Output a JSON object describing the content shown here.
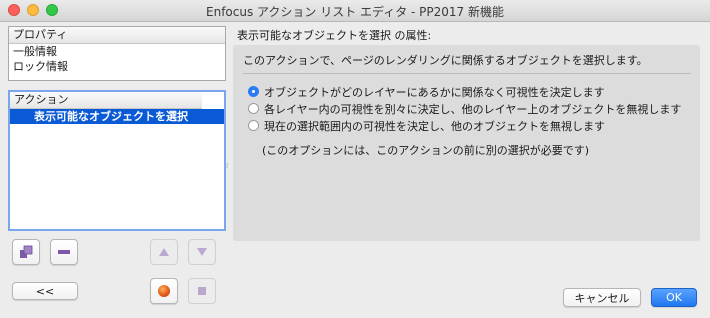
{
  "window": {
    "title": "Enfocus アクション リスト エディタ - PP2017 新機能"
  },
  "properties_panel": {
    "header": "プロパティ",
    "items": [
      "一般情報",
      "ロック情報"
    ]
  },
  "actions_panel": {
    "header": "アクション",
    "items": [
      "表示可能なオブジェクトを選択"
    ]
  },
  "toolbar": {
    "collapse_label": "<<",
    "icons": [
      "add-action-icon",
      "remove-action-icon",
      "move-up-icon",
      "move-down-icon",
      "record-icon",
      "stop-icon"
    ]
  },
  "attributes": {
    "heading": "表示可能なオブジェクトを選択 の属性:",
    "description": "このアクションで、ページのレンダリングに関係するオブジェクトを選択します。",
    "options": [
      "オブジェクトがどのレイヤーにあるかに関係なく可視性を決定します",
      "各レイヤー内の可視性を別々に決定し、他のレイヤー上のオブジェクトを無視します",
      "現在の選択範囲内の可視性を決定し、他のオブジェクトを無視します"
    ],
    "selected_option": 0,
    "note": "(このオプションには、このアクションの前に別の選択が必要です)"
  },
  "buttons": {
    "cancel": "キャンセル",
    "ok": "OK"
  },
  "colors": {
    "selection": "#0a5ad6",
    "accent": "#2b7cf2",
    "record": "#e8590c"
  }
}
